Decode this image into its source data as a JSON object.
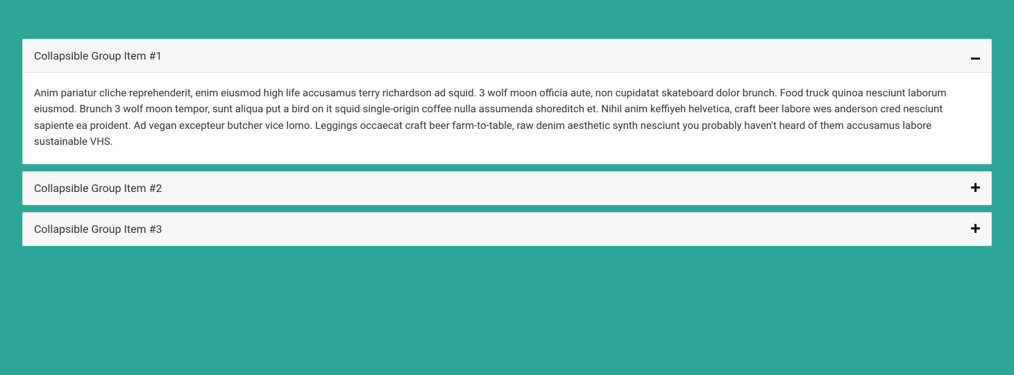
{
  "accordion": {
    "items": [
      {
        "title": "Collapsible Group Item #1",
        "expanded": true,
        "body": "Anim pariatur cliche reprehenderit, enim eiusmod high life accusamus terry richardson ad squid. 3 wolf moon officia aute, non cupidatat skateboard dolor brunch. Food truck quinoa nesciunt laborum eiusmod. Brunch 3 wolf moon tempor, sunt aliqua put a bird on it squid single-origin coffee nulla assumenda shoreditch et. Nihil anim keffiyeh helvetica, craft beer labore wes anderson cred nesciunt sapiente ea proident. Ad vegan excepteur butcher vice lomo. Leggings occaecat craft beer farm-to-table, raw denim aesthetic synth nesciunt you probably haven't heard of them accusamus labore sustainable VHS."
      },
      {
        "title": "Collapsible Group Item #2",
        "expanded": false,
        "body": ""
      },
      {
        "title": "Collapsible Group Item #3",
        "expanded": false,
        "body": ""
      }
    ]
  }
}
